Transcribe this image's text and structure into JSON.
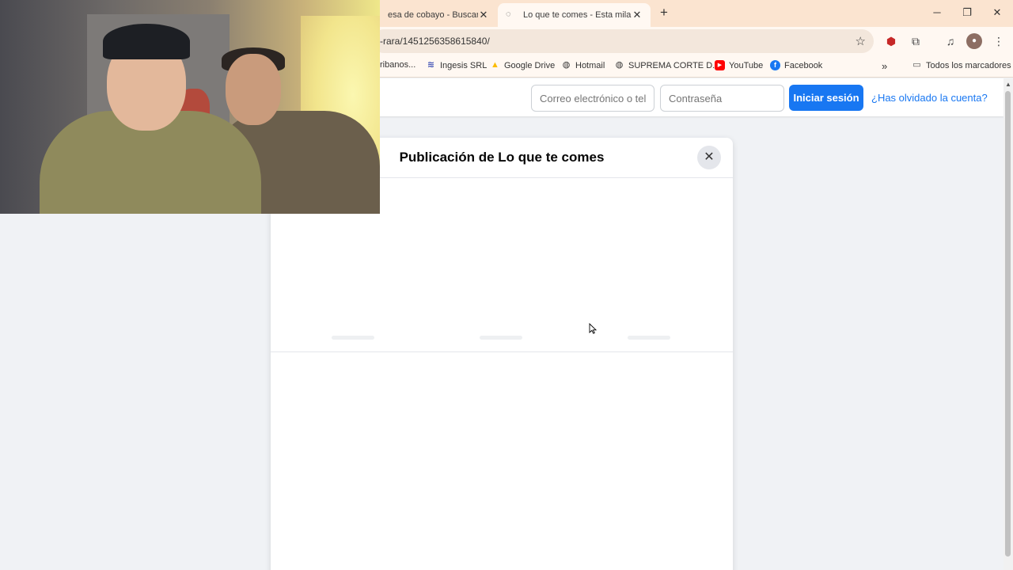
{
  "browser": {
    "tabs": [
      {
        "title": "esa de cobayo - Buscar co",
        "active": false
      },
      {
        "title": "Lo que te comes - Esta milanes",
        "active": true
      }
    ],
    "new_tab_symbol": "+",
    "tab_close_symbol": "✕",
    "window_controls": {
      "minimize": "─",
      "restore": "❐",
      "close": "✕"
    },
    "url": "-rara/1451256358615840/",
    "bookmarks": [
      {
        "label": "ribanos...",
        "icon": "bookmark-icon"
      },
      {
        "label": "Ingesis SRL",
        "icon": "ingesis-icon"
      },
      {
        "label": "Google Drive",
        "icon": "google-drive-icon"
      },
      {
        "label": "Hotmail",
        "icon": "globe-icon"
      },
      {
        "label": "SUPREMA CORTE D...",
        "icon": "globe-icon"
      },
      {
        "label": "YouTube",
        "icon": "youtube-icon"
      },
      {
        "label": "Facebook",
        "icon": "facebook-icon"
      }
    ],
    "bookmarks_overflow": "»",
    "all_bookmarks_label": "Todos los marcadores"
  },
  "header": {
    "email_placeholder": "Correo electrónico o tel",
    "password_placeholder": "Contraseña",
    "login_label": "Iniciar sesión",
    "forgot_label": "¿Has olvidado la cuenta?"
  },
  "dialog": {
    "title": "Publicación de Lo que te comes",
    "close_symbol": "✕"
  },
  "colors": {
    "facebook_blue": "#1877f2",
    "page_background": "#f0f2f5",
    "tabstrip_background": "#fbe4d0"
  }
}
